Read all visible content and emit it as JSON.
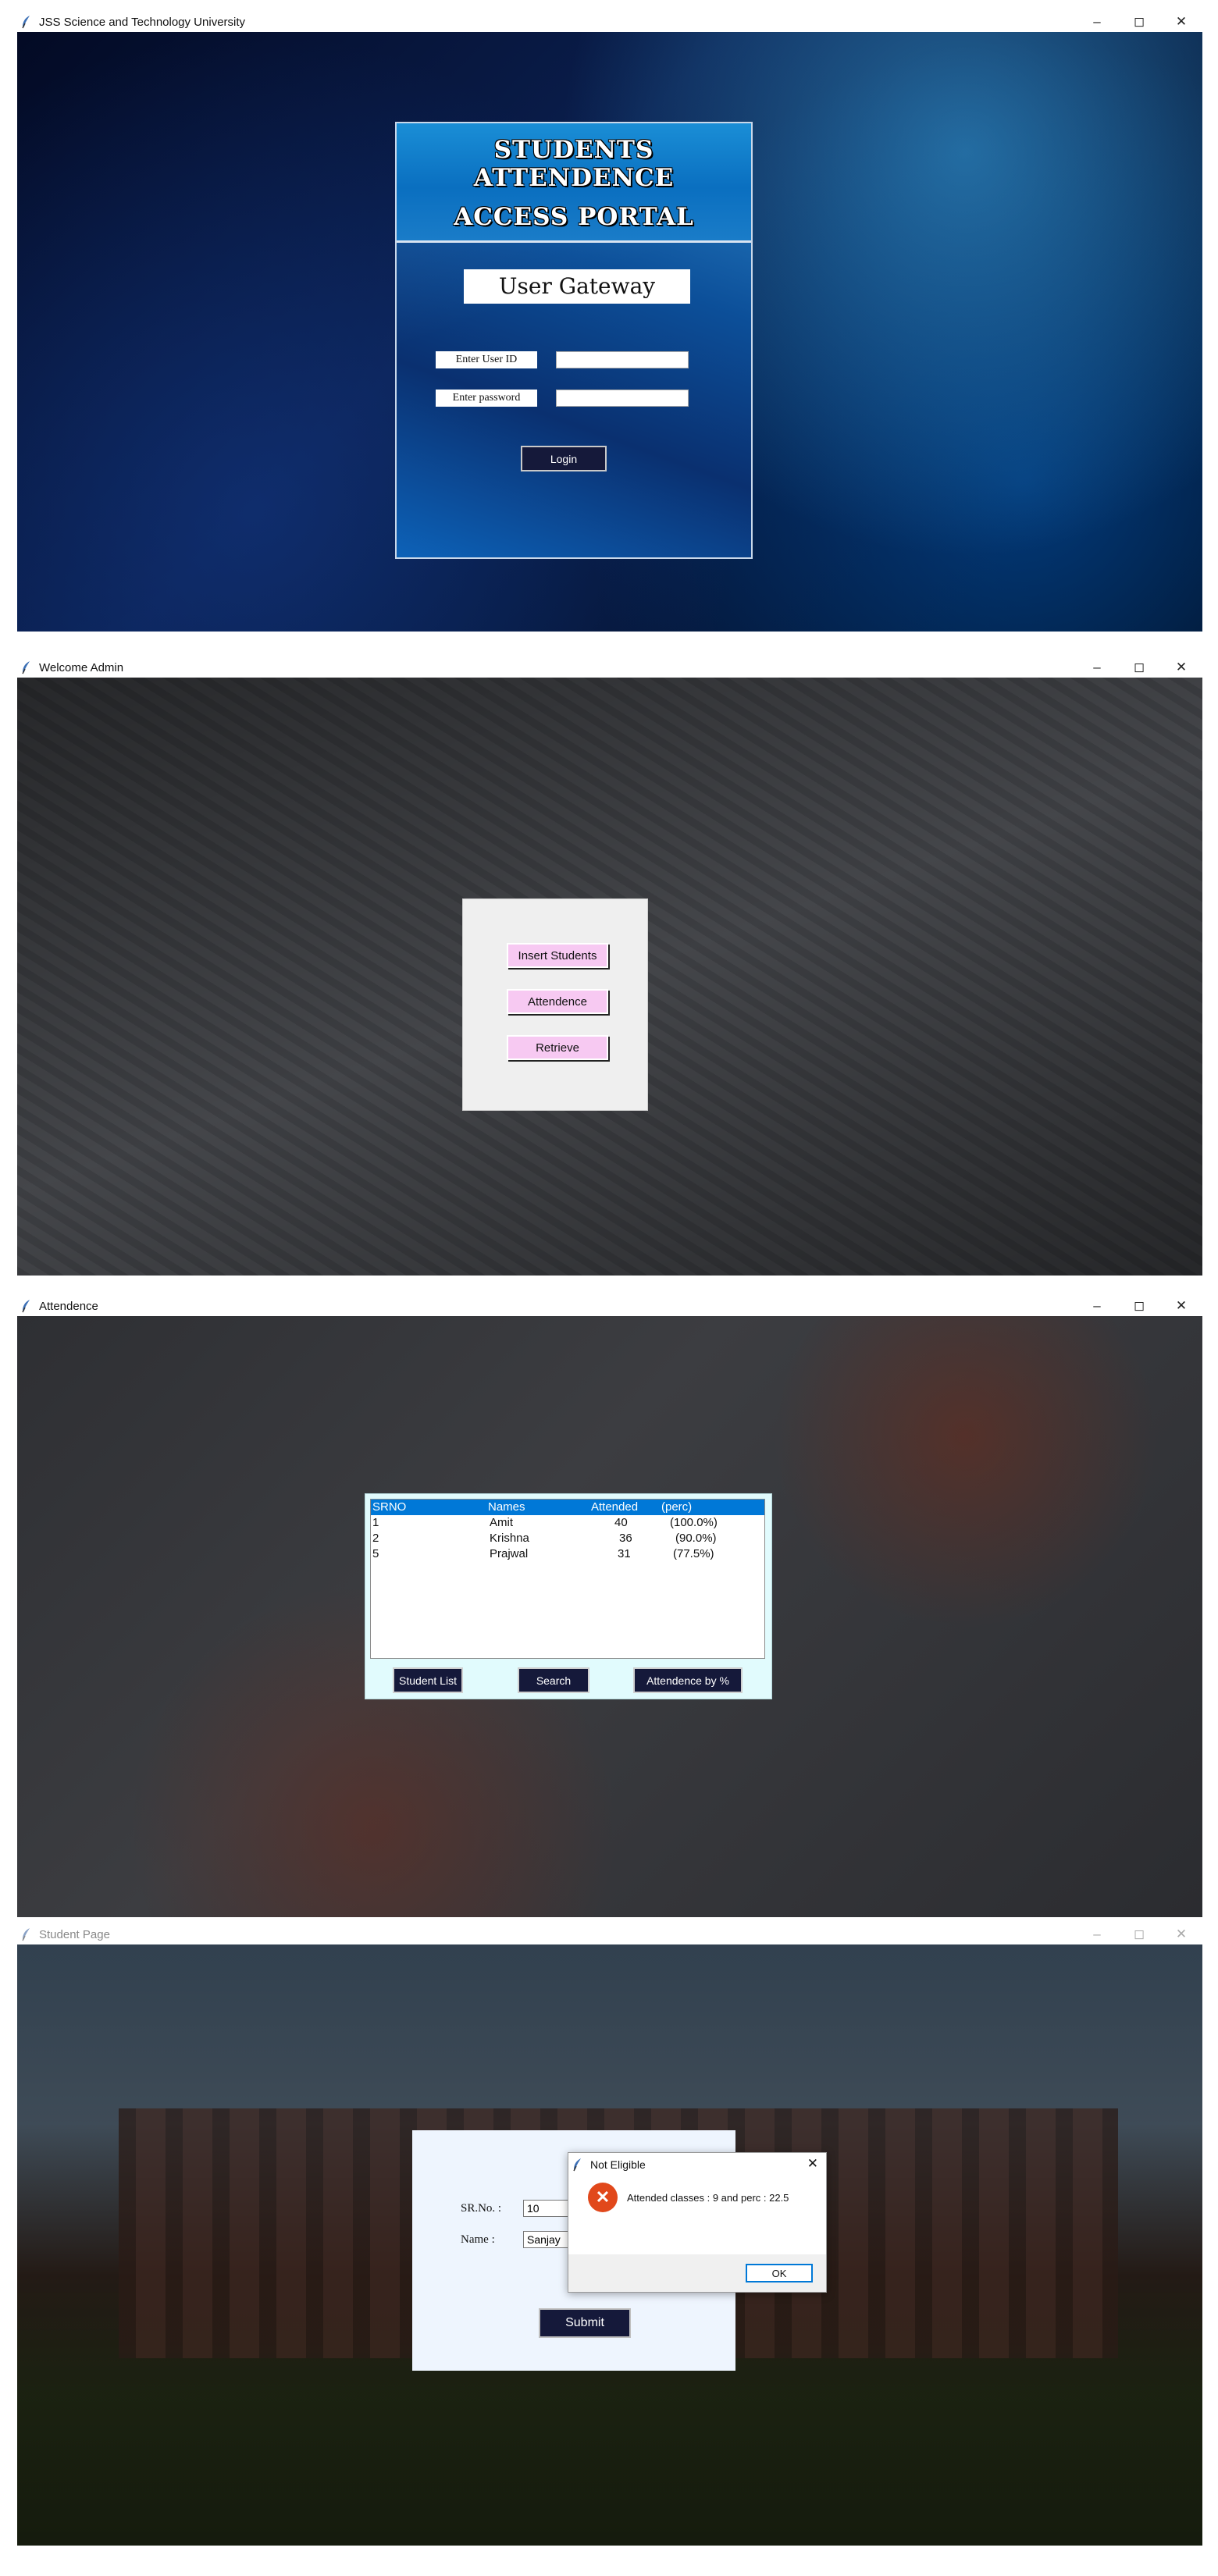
{
  "login_window": {
    "title": "JSS Science and Technology University",
    "header_line1": "STUDENTS ATTENDENCE",
    "header_line2": "ACCESS PORTAL",
    "gateway_title": "User Gateway",
    "user_id_label": "Enter User ID",
    "user_id_value": "",
    "password_label": "Enter password",
    "password_value": "",
    "login_button": "Login"
  },
  "admin_window": {
    "title": "Welcome Admin",
    "buttons": [
      "Insert Students",
      "Attendence",
      "Retrieve"
    ]
  },
  "attendance_window": {
    "title": "Attendence",
    "columns": [
      "SRNO",
      "Names",
      "Attended",
      "(perc)"
    ],
    "rows": [
      {
        "srno": "1",
        "name": "Amit",
        "attended": "40",
        "perc": "(100.0%)"
      },
      {
        "srno": "2",
        "name": "Krishna",
        "attended": "36",
        "perc": "(90.0%)"
      },
      {
        "srno": "5",
        "name": "Prajwal",
        "attended": "31",
        "perc": "(77.5%)"
      }
    ],
    "buttons": [
      "Student List",
      "Search",
      "Attendence by %"
    ]
  },
  "student_window": {
    "title": "Student Page",
    "srno_label": "SR.No. :",
    "srno_value": "10",
    "name_label": "Name :",
    "name_value": "Sanjay",
    "submit_button": "Submit"
  },
  "dialog": {
    "title": "Not Eligible",
    "message": "Attended classes : 9   and perc : 22.5",
    "ok_button": "OK",
    "icon": "error-icon"
  },
  "window_controls": {
    "minimize": "–",
    "maximize": "◻",
    "close": "✕"
  }
}
